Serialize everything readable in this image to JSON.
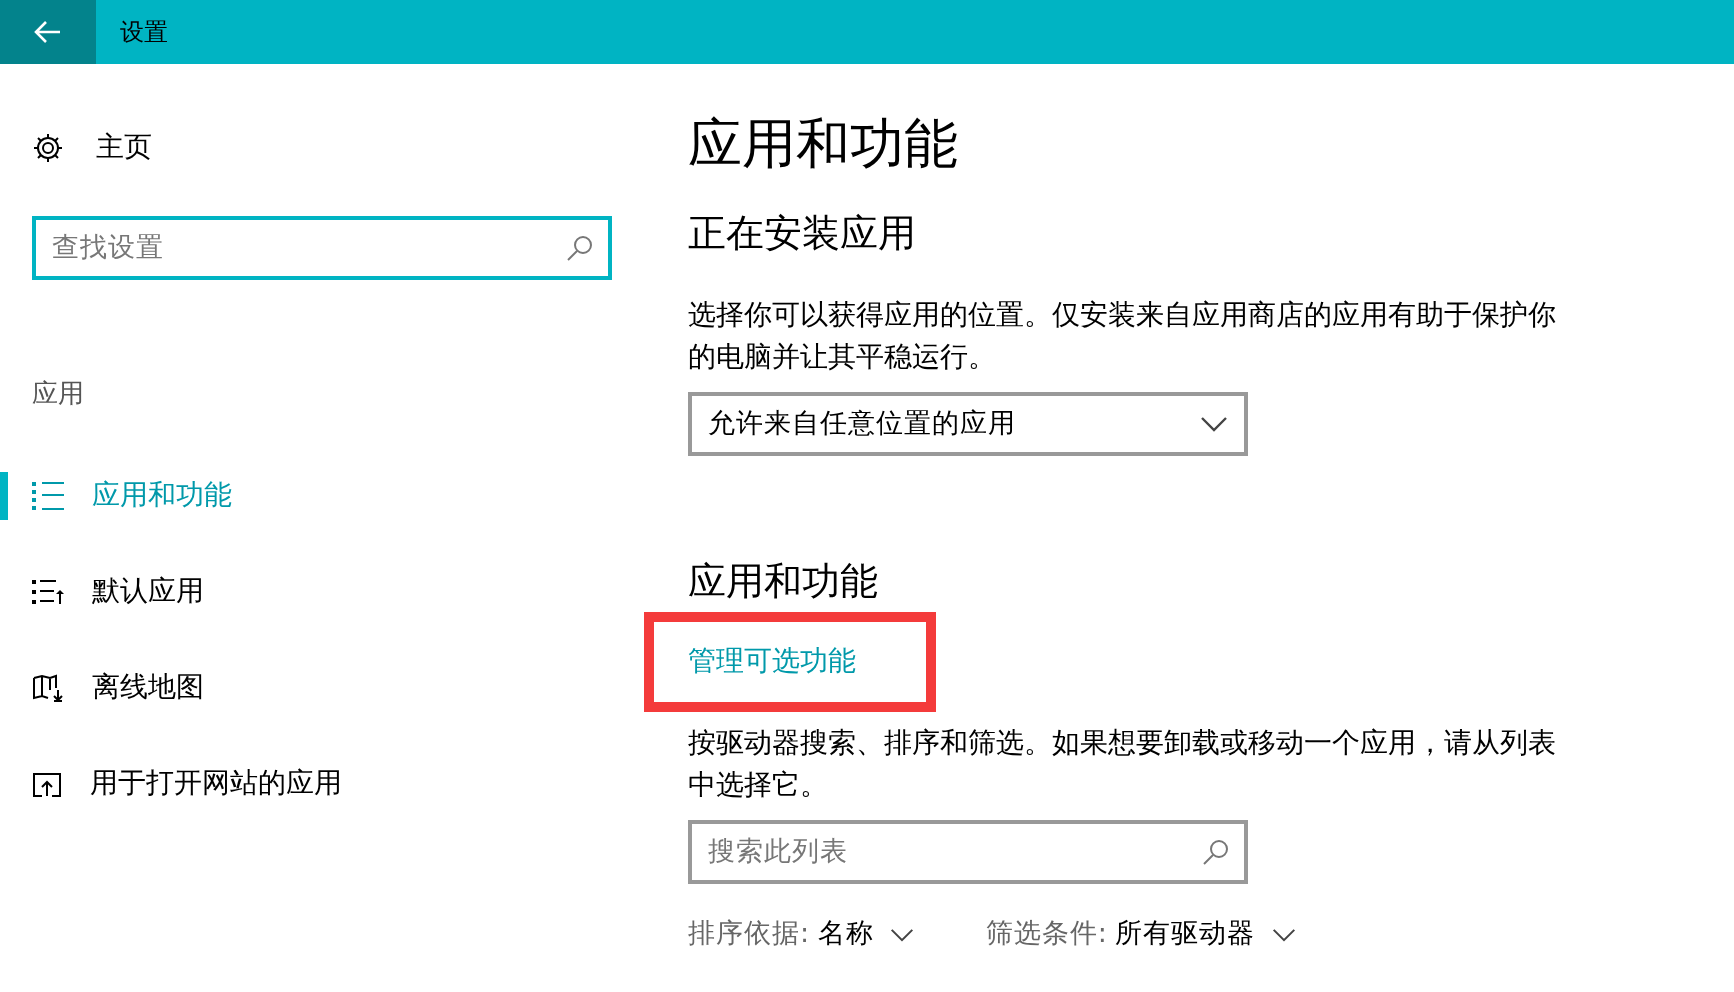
{
  "window": {
    "title": "设置"
  },
  "sidebar": {
    "home": "主页",
    "search": {
      "placeholder": "查找设置"
    },
    "section": "应用",
    "items": [
      {
        "label": "应用和功能",
        "kind": "list",
        "selected": true
      },
      {
        "label": "默认应用",
        "kind": "defaults",
        "selected": false
      },
      {
        "label": "离线地图",
        "kind": "map",
        "selected": false
      },
      {
        "label": "用于打开网站的应用",
        "kind": "web",
        "selected": false
      }
    ]
  },
  "main": {
    "title": "应用和功能",
    "install": {
      "heading": "正在安装应用",
      "description": "选择你可以获得应用的位置。仅安装来自应用商店的应用有助于保护你的电脑并让其平稳运行。",
      "dropdown": "允许来自任意位置的应用"
    },
    "apps": {
      "heading": "应用和功能",
      "link": {
        "label": "管理可选功能",
        "highlighted": true
      },
      "description": "按驱动器搜索、排序和筛选。如果想要卸载或移动一个应用，请从列表中选择它。",
      "search": {
        "placeholder": "搜索此列表"
      },
      "filters": [
        {
          "label": "排序依据:",
          "value": "名称"
        },
        {
          "label": "筛选条件:",
          "value": "所有驱动器"
        }
      ]
    }
  }
}
